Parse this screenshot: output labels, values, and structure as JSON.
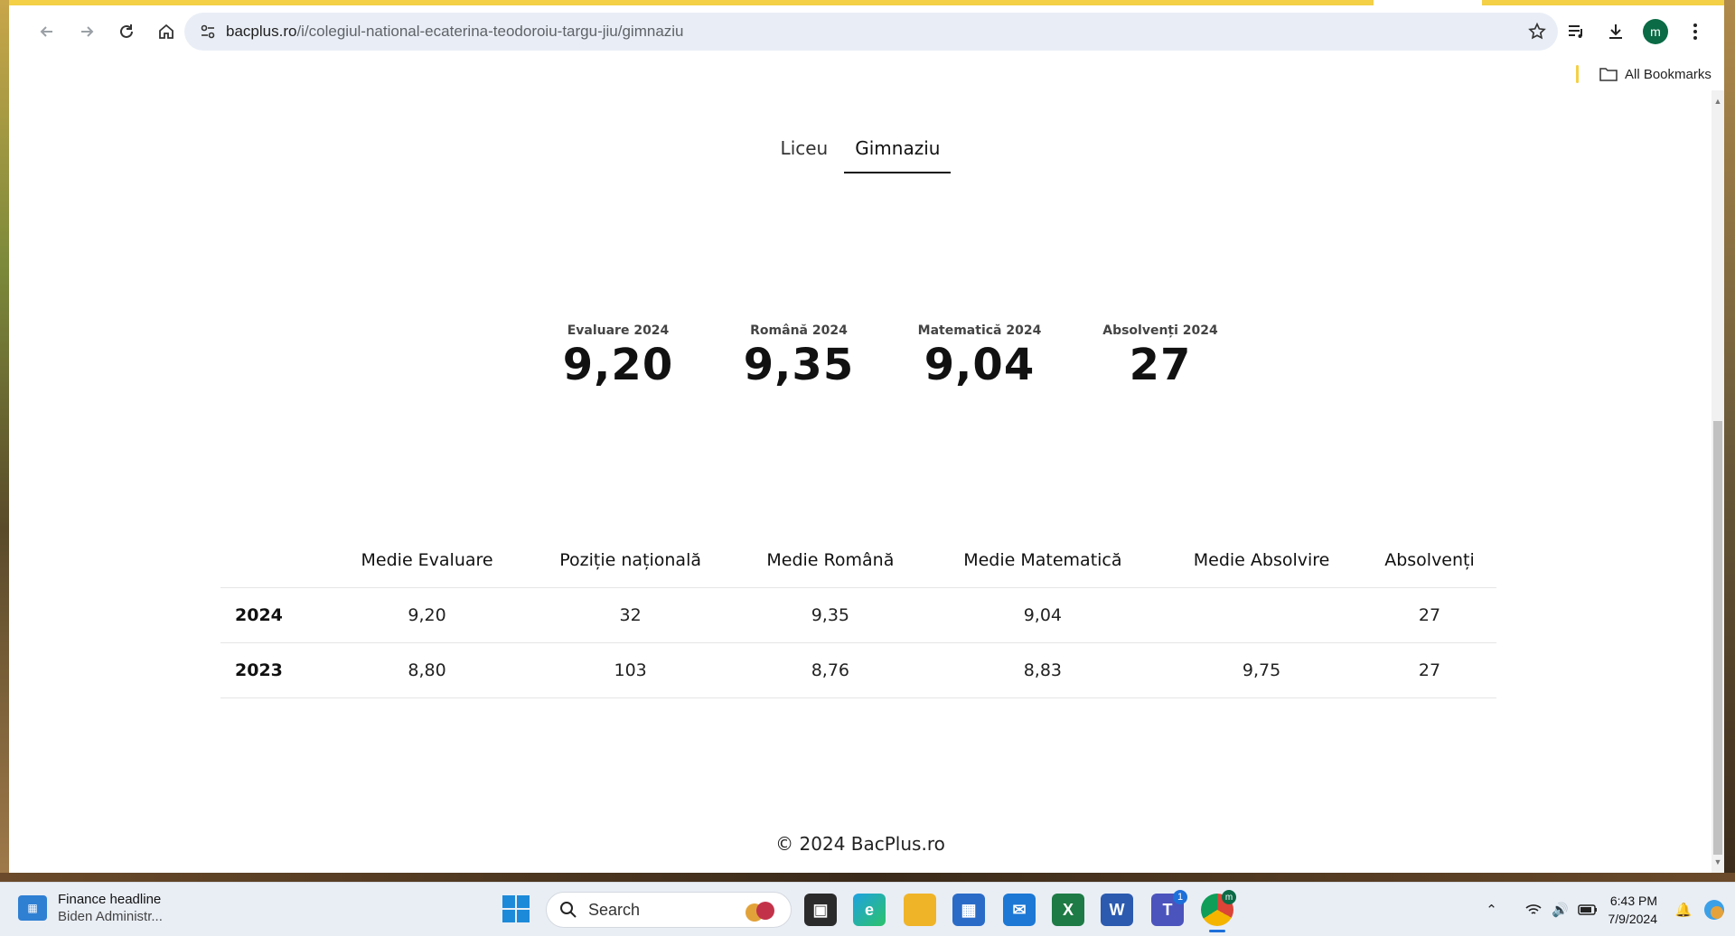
{
  "browser": {
    "url_host": "bacplus.ro",
    "url_path": "/i/colegiul-national-ecaterina-teodoroiu-targu-jiu/gimnaziu",
    "avatar_letter": "m",
    "bookmarks_label": "All Bookmarks"
  },
  "tabs": [
    {
      "label": "Liceu",
      "active": false
    },
    {
      "label": "Gimnaziu",
      "active": true
    }
  ],
  "stats": [
    {
      "label": "Evaluare 2024",
      "value": "9,20"
    },
    {
      "label": "Română 2024",
      "value": "9,35"
    },
    {
      "label": "Matematică 2024",
      "value": "9,04"
    },
    {
      "label": "Absolvenți 2024",
      "value": "27"
    }
  ],
  "table": {
    "headers": [
      "",
      "Medie Evaluare",
      "Poziție națională",
      "Medie Română",
      "Medie Matematică",
      "Medie Absolvire",
      "Absolvenți"
    ],
    "rows": [
      [
        "2024",
        "9,20",
        "32",
        "9,35",
        "9,04",
        "",
        "27"
      ],
      [
        "2023",
        "8,80",
        "103",
        "8,76",
        "8,83",
        "9,75",
        "27"
      ]
    ]
  },
  "footer": "© 2024 BacPlus.ro",
  "taskbar": {
    "news_title": "Finance headline",
    "news_subtitle": "Biden Administr...",
    "search_placeholder": "Search",
    "time": "6:43 PM",
    "date": "7/9/2024",
    "teams_badge": "1",
    "chrome_badge": "m"
  }
}
